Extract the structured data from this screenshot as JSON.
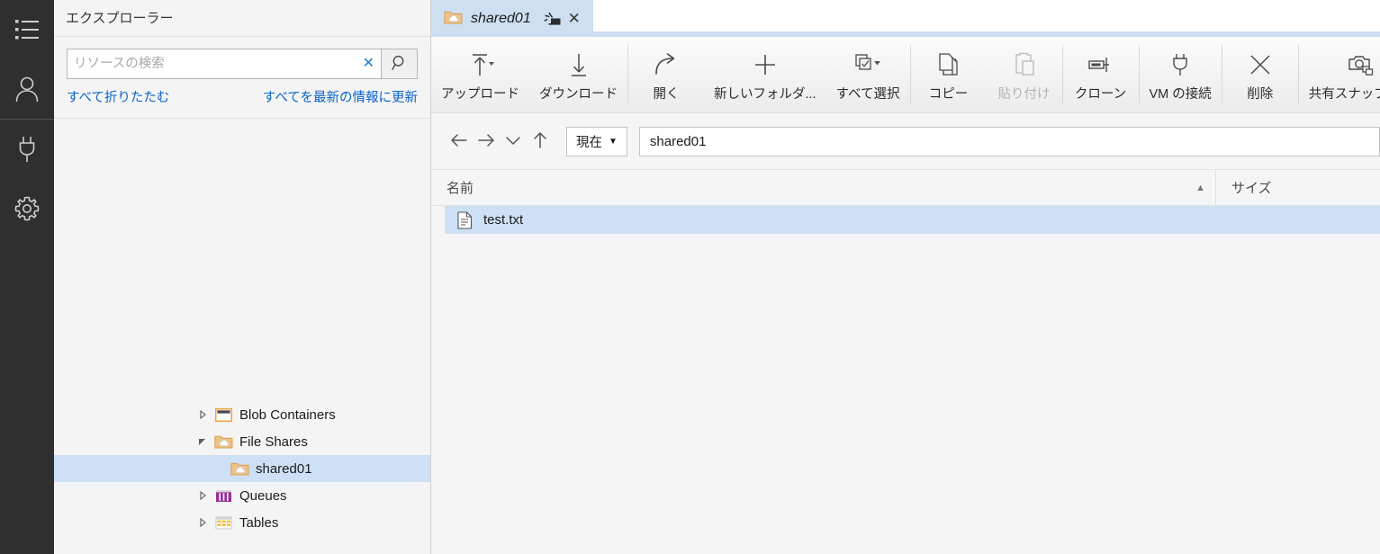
{
  "rail": {
    "items": [
      {
        "name": "explorer",
        "icon": "list-icon"
      },
      {
        "name": "account",
        "icon": "person-icon"
      },
      {
        "name": "connect",
        "icon": "plug-icon"
      },
      {
        "name": "settings",
        "icon": "gear-icon"
      }
    ]
  },
  "sidebar": {
    "title": "エクスプローラー",
    "search": {
      "placeholder": "リソースの検索",
      "value": "",
      "clear_label": "✕",
      "search_icon": "magnifier-icon"
    },
    "links": {
      "collapse_all": "すべて折りたたむ",
      "refresh_all": "すべてを最新の情報に更新"
    },
    "tree": [
      {
        "label": "Blob Containers",
        "expanded": false,
        "arrow": "▸",
        "icon": "blob-container-icon",
        "selected": false,
        "indent": 1
      },
      {
        "label": "File Shares",
        "expanded": true,
        "arrow": "◢",
        "icon": "file-share-icon",
        "selected": false,
        "indent": 1
      },
      {
        "label": "shared01",
        "expanded": false,
        "arrow": "",
        "icon": "file-share-icon",
        "selected": true,
        "indent": 2
      },
      {
        "label": "Queues",
        "expanded": false,
        "arrow": "▸",
        "icon": "queue-icon",
        "selected": false,
        "indent": 1
      },
      {
        "label": "Tables",
        "expanded": false,
        "arrow": "▸",
        "icon": "table-icon",
        "selected": false,
        "indent": 1
      }
    ]
  },
  "tab": {
    "title": "shared01",
    "icon": "file-share-icon",
    "pin_icon": "pin-tab-icon",
    "close_label": "✕"
  },
  "toolbar": {
    "buttons": [
      {
        "label": "アップロード",
        "icon": "upload-icon",
        "has_dropdown": true,
        "disabled": false
      },
      {
        "label": "ダウンロード",
        "icon": "download-icon",
        "has_dropdown": false,
        "disabled": false
      },
      {
        "label": "開く",
        "icon": "open-icon",
        "has_dropdown": false,
        "disabled": false
      },
      {
        "label": "新しいフォルダ...",
        "icon": "new-folder-icon",
        "has_dropdown": false,
        "disabled": false
      },
      {
        "label": "すべて選択",
        "icon": "select-all-icon",
        "has_dropdown": true,
        "disabled": false
      },
      {
        "label": "コピー",
        "icon": "copy-icon",
        "has_dropdown": false,
        "disabled": false
      },
      {
        "label": "貼り付け",
        "icon": "paste-icon",
        "has_dropdown": false,
        "disabled": true
      },
      {
        "label": "クローン",
        "icon": "clone-icon",
        "has_dropdown": false,
        "disabled": false
      },
      {
        "label": "VM の接続",
        "icon": "plug-icon",
        "has_dropdown": false,
        "disabled": false
      },
      {
        "label": "削除",
        "icon": "delete-icon",
        "has_dropdown": false,
        "disabled": false
      },
      {
        "label": "共有スナップショ",
        "icon": "share-snapshot-icon",
        "has_dropdown": false,
        "disabled": false
      }
    ]
  },
  "navbar": {
    "back_icon": "arrow-left-icon",
    "forward_icon": "arrow-right-icon",
    "history_icon": "chevron-down-icon",
    "up_icon": "arrow-up-icon",
    "scope_label": "現在",
    "scope_caret": "▼",
    "path_value": "shared01"
  },
  "file_list": {
    "columns": {
      "name": "名前",
      "size": "サイズ"
    },
    "sort_caret": "▲",
    "rows": [
      {
        "name": "test.txt",
        "size": "",
        "icon": "text-file-icon",
        "selected": true
      }
    ]
  },
  "colors": {
    "rail_bg": "#2f2f2f",
    "sidebar_bg": "#f4f4f4",
    "selection": "#cde0f5",
    "tab_bg": "#cddff1",
    "link": "#0a63c9",
    "accent_blue": "#1a7fd4",
    "folder_orange": "#e8b465",
    "queue_purple": "#9b2f9b",
    "table_orange": "#e8a33d"
  }
}
